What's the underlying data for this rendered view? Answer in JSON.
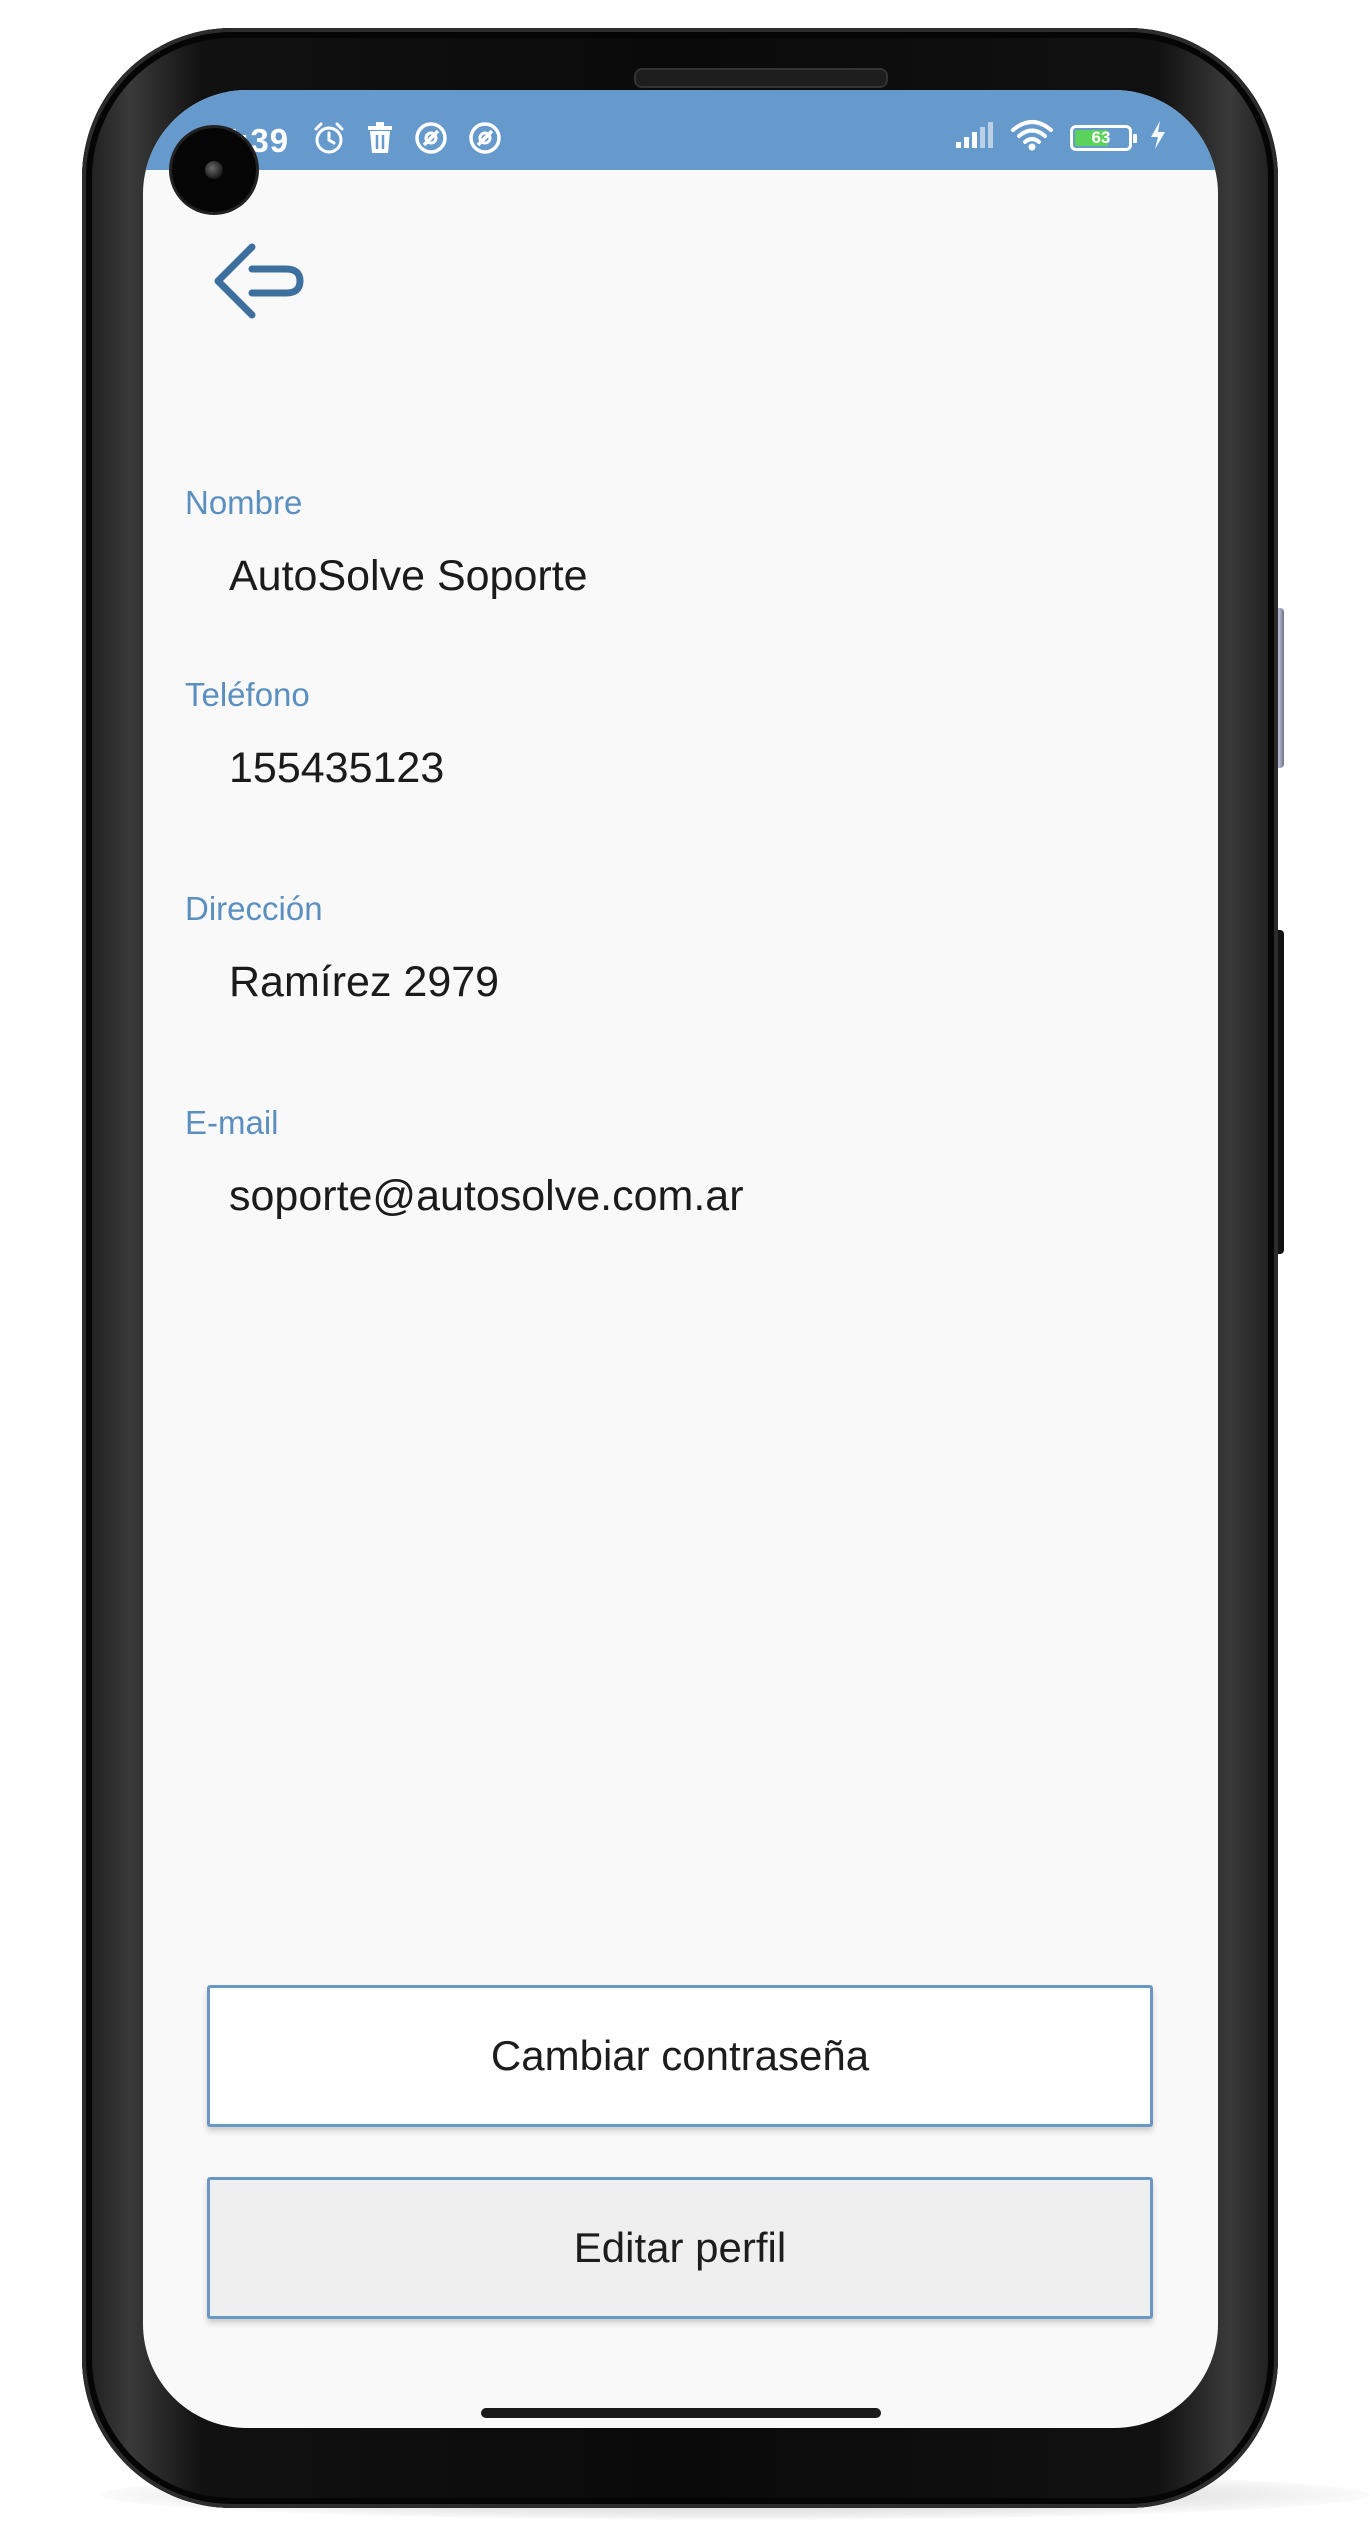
{
  "status_bar": {
    "time": "7:39",
    "battery_level": "63",
    "battery_fraction": 0.63,
    "accent_color": "#6699cc"
  },
  "nav": {
    "back_icon": "arrow-left-icon"
  },
  "profile": {
    "fields": [
      {
        "label": "Nombre",
        "value": "AutoSolve Soporte"
      },
      {
        "label": "Teléfono",
        "value": "155435123"
      },
      {
        "label": "Dirección",
        "value": "Ramírez 2979"
      },
      {
        "label": "E-mail",
        "value": "soporte@autosolve.com.ar"
      }
    ]
  },
  "actions": {
    "change_password_label": "Cambiar contraseña",
    "edit_profile_label": "Editar perfil"
  },
  "colors": {
    "label": "#5b8fbf",
    "button_border": "#6a97c3",
    "edit_button_bg": "#efefef"
  }
}
